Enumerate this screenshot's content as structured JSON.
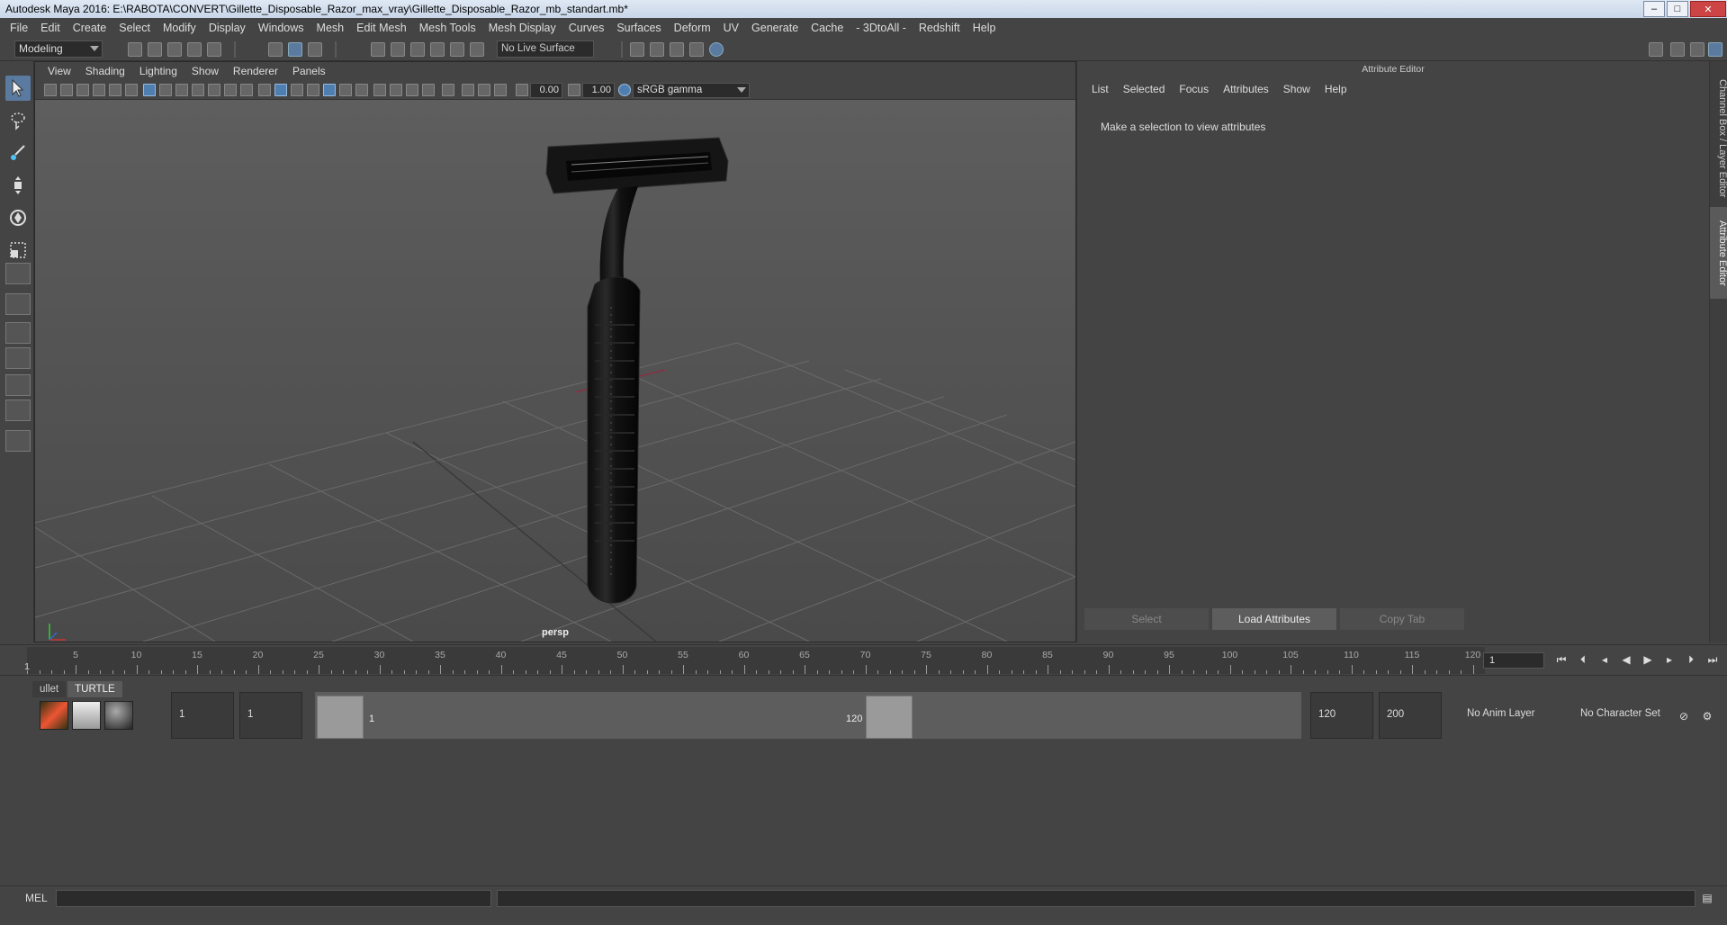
{
  "window": {
    "title": "Autodesk Maya 2016: E:\\RABOTA\\CONVERT\\Gillette_Disposable_Razor_max_vray\\Gillette_Disposable_Razor_mb_standart.mb*"
  },
  "menubar": [
    "File",
    "Edit",
    "Create",
    "Select",
    "Modify",
    "Display",
    "Windows",
    "Mesh",
    "Edit Mesh",
    "Mesh Tools",
    "Mesh Display",
    "Curves",
    "Surfaces",
    "Deform",
    "UV",
    "Generate",
    "Cache",
    "- 3DtoAll -",
    "Redshift",
    "Help"
  ],
  "toolbar": {
    "mode": "Modeling",
    "live_surface": "No Live Surface"
  },
  "viewport": {
    "menus": [
      "View",
      "Shading",
      "Lighting",
      "Show",
      "Renderer",
      "Panels"
    ],
    "exposure": "0.00",
    "gamma_value": "1.00",
    "color_space": "sRGB gamma",
    "camera_label": "persp"
  },
  "attribute_editor": {
    "title": "Attribute Editor",
    "menus": [
      "List",
      "Selected",
      "Focus",
      "Attributes",
      "Show",
      "Help"
    ],
    "message": "Make a selection to view attributes",
    "buttons": [
      "Select",
      "Load Attributes",
      "Copy Tab"
    ]
  },
  "side_tabs": [
    "Channel Box / Layer Editor",
    "Attribute Editor"
  ],
  "timeline": {
    "ticks": [
      "5",
      "10",
      "15",
      "20",
      "25",
      "30",
      "35",
      "40",
      "45",
      "50",
      "55",
      "60",
      "65",
      "70",
      "75",
      "80",
      "85",
      "90",
      "95",
      "100",
      "105",
      "110",
      "115",
      "120"
    ],
    "start_label": "1",
    "current_frame": "1"
  },
  "range": {
    "shelf_tabs": [
      "ullet",
      "TURTLE"
    ],
    "start": "1",
    "playback_start": "1",
    "range_start": "1",
    "range_end": "120",
    "playback_end": "120",
    "end": "200",
    "anim_layer": "No Anim Layer",
    "character_set": "No Character Set"
  },
  "cmd": {
    "label": "MEL"
  }
}
